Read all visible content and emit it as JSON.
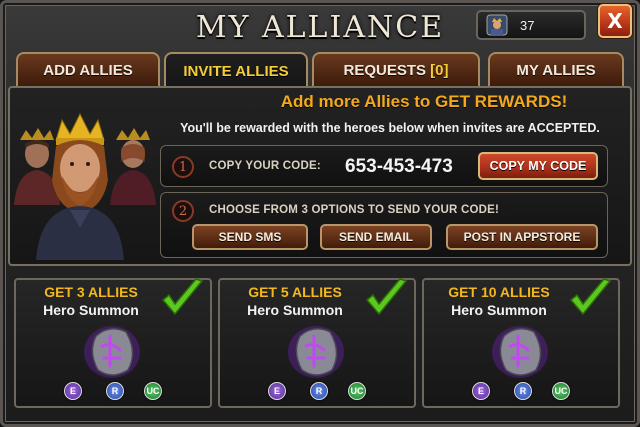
{
  "title": "MY ALLIANCE",
  "ally_count": "37",
  "close_label": "X",
  "tabs": [
    {
      "label": "ADD ALLIES",
      "active": false
    },
    {
      "label": "INVITE ALLIES",
      "active": true
    },
    {
      "label": "REQUESTS",
      "count": "[0]",
      "active": false
    },
    {
      "label": "MY ALLIES",
      "active": false
    }
  ],
  "invite": {
    "headline": "Add more Allies to GET REWARDS!",
    "subline": "You'll be rewarded with the heroes below when invites are ACCEPTED.",
    "step1": {
      "num": "1",
      "label": "COPY YOUR CODE:",
      "code": "653-453-473",
      "button": "COPY MY CODE"
    },
    "step2": {
      "num": "2",
      "label": "CHOOSE FROM 3 OPTIONS TO SEND YOUR CODE!",
      "buttons": [
        "SEND SMS",
        "SEND EMAIL",
        "POST IN APPSTORE"
      ]
    }
  },
  "rewards": [
    {
      "title": "GET 3 ALLIES",
      "subtitle": "Hero Summon",
      "completed": true,
      "badges": [
        "E",
        "R",
        "UC"
      ]
    },
    {
      "title": "GET 5 ALLIES",
      "subtitle": "Hero Summon",
      "completed": true,
      "badges": [
        "E",
        "R",
        "UC"
      ]
    },
    {
      "title": "GET 10 ALLIES",
      "subtitle": "Hero Summon",
      "completed": true,
      "badges": [
        "E",
        "R",
        "UC"
      ]
    }
  ],
  "colors": {
    "accent": "#f3a81e",
    "tab_active_text": "#f5cc3a",
    "button_red": "#b8361a",
    "button_brown": "#5a2c14",
    "rune_glow": "#a23ae8",
    "check_green": "#5cc81e"
  }
}
